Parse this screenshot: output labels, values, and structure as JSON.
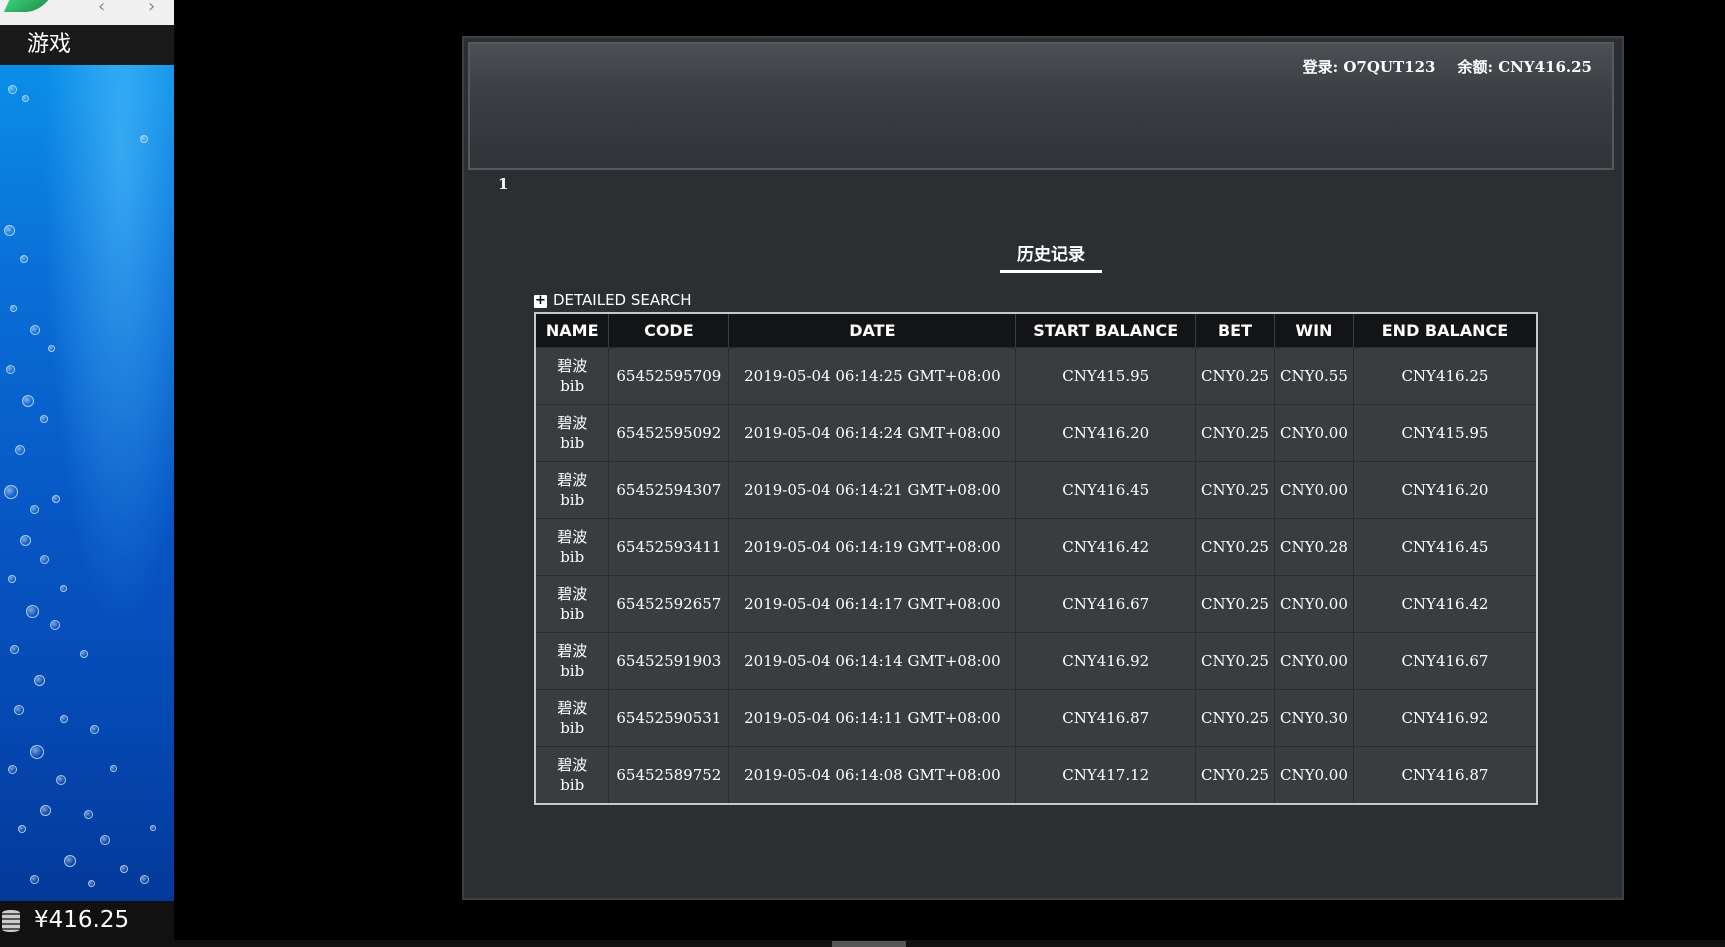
{
  "sidebar": {
    "games_label": "游戏",
    "balance": "¥416.25",
    "icons": {
      "back": "chevron-left-icon",
      "forward": "chevron-right-icon",
      "coins": "coin-stack-icon"
    }
  },
  "header": {
    "login_label": "登录: O7QUT123",
    "balance_label": "余额: CNY416.25"
  },
  "page_number": "1",
  "section_title": "历史记录",
  "detailed_search": {
    "icon": "+",
    "label": "DETAILED SEARCH"
  },
  "table": {
    "columns": [
      "NAME",
      "CODE",
      "DATE",
      "START BALANCE",
      "BET",
      "WIN",
      "END BALANCE"
    ],
    "rows": [
      {
        "name_cn": "碧波",
        "name_en": "bib",
        "code": "65452595709",
        "date": "2019-05-04 06:14:25 GMT+08:00",
        "start_balance": "CNY415.95",
        "bet": "CNY0.25",
        "win": "CNY0.55",
        "end_balance": "CNY416.25"
      },
      {
        "name_cn": "碧波",
        "name_en": "bib",
        "code": "65452595092",
        "date": "2019-05-04 06:14:24 GMT+08:00",
        "start_balance": "CNY416.20",
        "bet": "CNY0.25",
        "win": "CNY0.00",
        "end_balance": "CNY415.95"
      },
      {
        "name_cn": "碧波",
        "name_en": "bib",
        "code": "65452594307",
        "date": "2019-05-04 06:14:21 GMT+08:00",
        "start_balance": "CNY416.45",
        "bet": "CNY0.25",
        "win": "CNY0.00",
        "end_balance": "CNY416.20"
      },
      {
        "name_cn": "碧波",
        "name_en": "bib",
        "code": "65452593411",
        "date": "2019-05-04 06:14:19 GMT+08:00",
        "start_balance": "CNY416.42",
        "bet": "CNY0.25",
        "win": "CNY0.28",
        "end_balance": "CNY416.45"
      },
      {
        "name_cn": "碧波",
        "name_en": "bib",
        "code": "65452592657",
        "date": "2019-05-04 06:14:17 GMT+08:00",
        "start_balance": "CNY416.67",
        "bet": "CNY0.25",
        "win": "CNY0.00",
        "end_balance": "CNY416.42"
      },
      {
        "name_cn": "碧波",
        "name_en": "bib",
        "code": "65452591903",
        "date": "2019-05-04 06:14:14 GMT+08:00",
        "start_balance": "CNY416.92",
        "bet": "CNY0.25",
        "win": "CNY0.00",
        "end_balance": "CNY416.67"
      },
      {
        "name_cn": "碧波",
        "name_en": "bib",
        "code": "65452590531",
        "date": "2019-05-04 06:14:11 GMT+08:00",
        "start_balance": "CNY416.87",
        "bet": "CNY0.25",
        "win": "CNY0.30",
        "end_balance": "CNY416.92"
      },
      {
        "name_cn": "碧波",
        "name_en": "bib",
        "code": "65452589752",
        "date": "2019-05-04 06:14:08 GMT+08:00",
        "start_balance": "CNY417.12",
        "bet": "CNY0.25",
        "win": "CNY0.00",
        "end_balance": "CNY416.87"
      }
    ]
  }
}
